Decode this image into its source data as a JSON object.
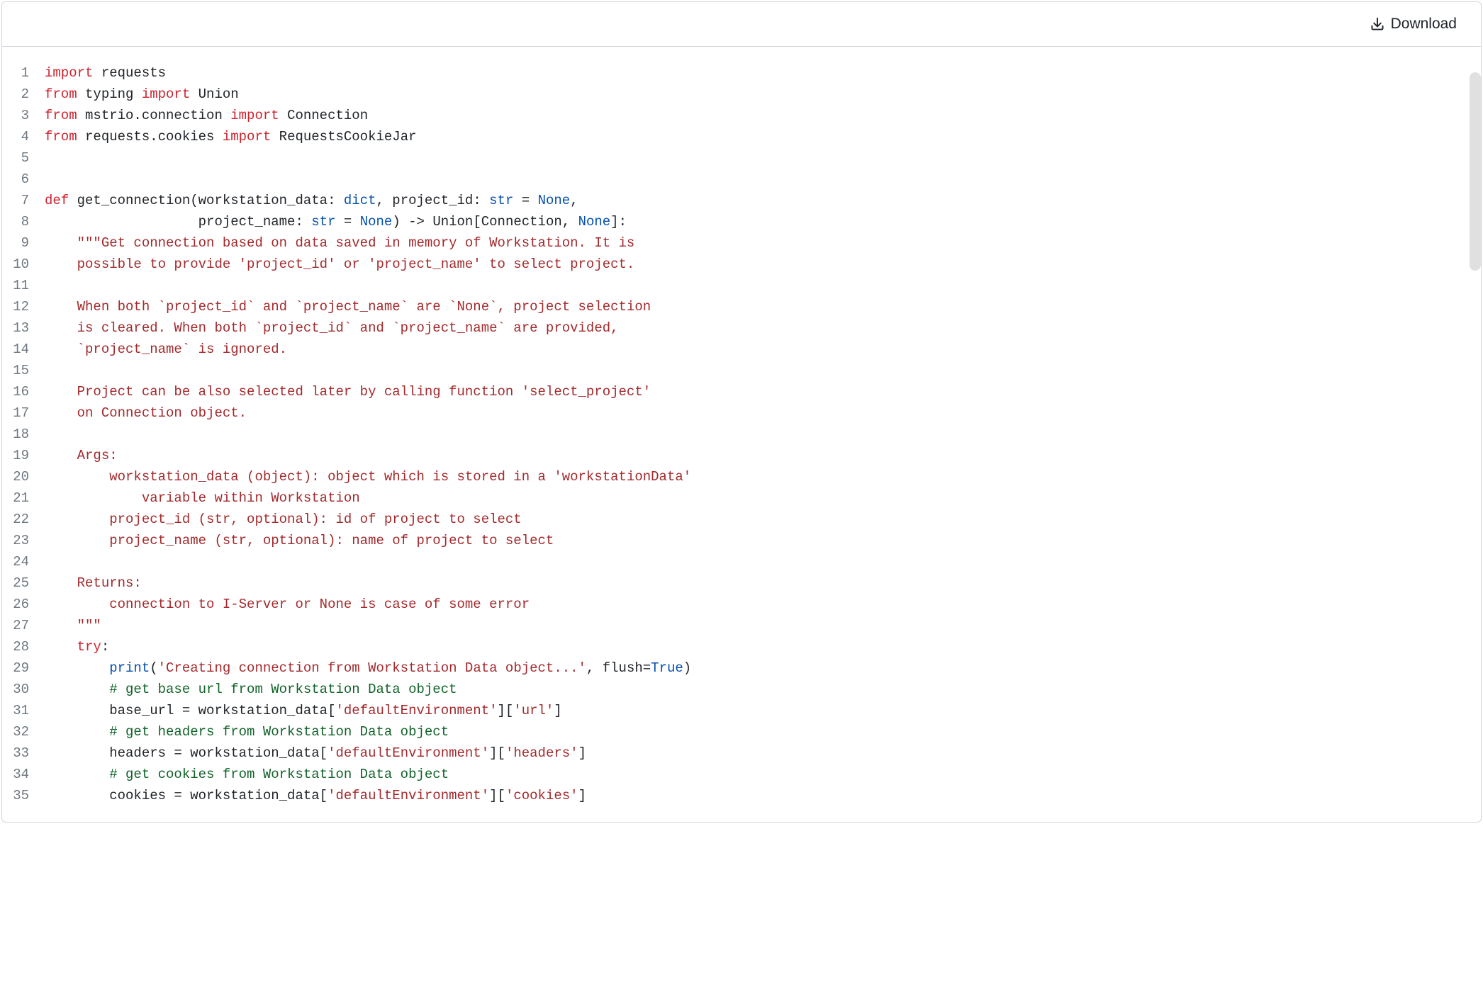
{
  "header": {
    "download_label": "Download"
  },
  "code": {
    "lines": [
      {
        "n": 1,
        "t": [
          [
            "kw",
            "import"
          ],
          [
            "p",
            " requests"
          ]
        ]
      },
      {
        "n": 2,
        "t": [
          [
            "kw",
            "from"
          ],
          [
            "p",
            " typing "
          ],
          [
            "kw",
            "import"
          ],
          [
            "p",
            " Union"
          ]
        ]
      },
      {
        "n": 3,
        "t": [
          [
            "kw",
            "from"
          ],
          [
            "p",
            " mstrio.connection "
          ],
          [
            "kw",
            "import"
          ],
          [
            "p",
            " Connection"
          ]
        ]
      },
      {
        "n": 4,
        "t": [
          [
            "kw",
            "from"
          ],
          [
            "p",
            " requests.cookies "
          ],
          [
            "kw",
            "import"
          ],
          [
            "p",
            " RequestsCookieJar"
          ]
        ]
      },
      {
        "n": 5,
        "t": [
          [
            "p",
            ""
          ]
        ]
      },
      {
        "n": 6,
        "t": [
          [
            "p",
            ""
          ]
        ]
      },
      {
        "n": 7,
        "t": [
          [
            "kw",
            "def"
          ],
          [
            "p",
            " get_connection(workstation_data: "
          ],
          [
            "builtin",
            "dict"
          ],
          [
            "p",
            ", project_id: "
          ],
          [
            "builtin",
            "str"
          ],
          [
            "p",
            " = "
          ],
          [
            "none",
            "None"
          ],
          [
            "p",
            ","
          ]
        ]
      },
      {
        "n": 8,
        "t": [
          [
            "p",
            "                   project_name: "
          ],
          [
            "builtin",
            "str"
          ],
          [
            "p",
            " = "
          ],
          [
            "none",
            "None"
          ],
          [
            "p",
            ") -> Union[Connection, "
          ],
          [
            "none",
            "None"
          ],
          [
            "p",
            "]:"
          ]
        ]
      },
      {
        "n": 9,
        "t": [
          [
            "p",
            "    "
          ],
          [
            "str",
            "\"\"\"Get connection based on data saved in memory of Workstation. It is"
          ]
        ]
      },
      {
        "n": 10,
        "t": [
          [
            "p",
            "    "
          ],
          [
            "str",
            "possible to provide 'project_id' or 'project_name' to select project."
          ]
        ]
      },
      {
        "n": 11,
        "t": [
          [
            "p",
            ""
          ]
        ]
      },
      {
        "n": 12,
        "t": [
          [
            "p",
            "    "
          ],
          [
            "str",
            "When both `project_id` and `project_name` are `None`, project selection"
          ]
        ]
      },
      {
        "n": 13,
        "t": [
          [
            "p",
            "    "
          ],
          [
            "str",
            "is cleared. When both `project_id` and `project_name` are provided,"
          ]
        ]
      },
      {
        "n": 14,
        "t": [
          [
            "p",
            "    "
          ],
          [
            "str",
            "`project_name` is ignored."
          ]
        ]
      },
      {
        "n": 15,
        "t": [
          [
            "p",
            ""
          ]
        ]
      },
      {
        "n": 16,
        "t": [
          [
            "p",
            "    "
          ],
          [
            "str",
            "Project can be also selected later by calling function 'select_project'"
          ]
        ]
      },
      {
        "n": 17,
        "t": [
          [
            "p",
            "    "
          ],
          [
            "str",
            "on Connection object."
          ]
        ]
      },
      {
        "n": 18,
        "t": [
          [
            "p",
            ""
          ]
        ]
      },
      {
        "n": 19,
        "t": [
          [
            "p",
            "    "
          ],
          [
            "str",
            "Args:"
          ]
        ]
      },
      {
        "n": 20,
        "t": [
          [
            "p",
            "        "
          ],
          [
            "str",
            "workstation_data (object): object which is stored in a 'workstationData'"
          ]
        ]
      },
      {
        "n": 21,
        "t": [
          [
            "p",
            "            "
          ],
          [
            "str",
            "variable within Workstation"
          ]
        ]
      },
      {
        "n": 22,
        "t": [
          [
            "p",
            "        "
          ],
          [
            "str",
            "project_id (str, optional): id of project to select"
          ]
        ]
      },
      {
        "n": 23,
        "t": [
          [
            "p",
            "        "
          ],
          [
            "str",
            "project_name (str, optional): name of project to select"
          ]
        ]
      },
      {
        "n": 24,
        "t": [
          [
            "p",
            ""
          ]
        ]
      },
      {
        "n": 25,
        "t": [
          [
            "p",
            "    "
          ],
          [
            "str",
            "Returns:"
          ]
        ]
      },
      {
        "n": 26,
        "t": [
          [
            "p",
            "        "
          ],
          [
            "str",
            "connection to I-Server or None is case of some error"
          ]
        ]
      },
      {
        "n": 27,
        "t": [
          [
            "p",
            "    "
          ],
          [
            "str",
            "\"\"\""
          ]
        ]
      },
      {
        "n": 28,
        "t": [
          [
            "p",
            "    "
          ],
          [
            "kw",
            "try"
          ],
          [
            "p",
            ":"
          ]
        ]
      },
      {
        "n": 29,
        "t": [
          [
            "p",
            "        "
          ],
          [
            "print",
            "print"
          ],
          [
            "p",
            "("
          ],
          [
            "str",
            "'Creating connection from Workstation Data object...'"
          ],
          [
            "p",
            ", flush="
          ],
          [
            "true",
            "True"
          ],
          [
            "p",
            ")"
          ]
        ]
      },
      {
        "n": 30,
        "t": [
          [
            "p",
            "        "
          ],
          [
            "comment",
            "# get base url from Workstation Data object"
          ]
        ]
      },
      {
        "n": 31,
        "t": [
          [
            "p",
            "        base_url = workstation_data["
          ],
          [
            "str",
            "'defaultEnvironment'"
          ],
          [
            "p",
            "]["
          ],
          [
            "str",
            "'url'"
          ],
          [
            "p",
            "]"
          ]
        ]
      },
      {
        "n": 32,
        "t": [
          [
            "p",
            "        "
          ],
          [
            "comment",
            "# get headers from Workstation Data object"
          ]
        ]
      },
      {
        "n": 33,
        "t": [
          [
            "p",
            "        headers = workstation_data["
          ],
          [
            "str",
            "'defaultEnvironment'"
          ],
          [
            "p",
            "]["
          ],
          [
            "str",
            "'headers'"
          ],
          [
            "p",
            "]"
          ]
        ]
      },
      {
        "n": 34,
        "t": [
          [
            "p",
            "        "
          ],
          [
            "comment",
            "# get cookies from Workstation Data object"
          ]
        ]
      },
      {
        "n": 35,
        "t": [
          [
            "p",
            "        cookies = workstation_data["
          ],
          [
            "str",
            "'defaultEnvironment'"
          ],
          [
            "p",
            "]["
          ],
          [
            "str",
            "'cookies'"
          ],
          [
            "p",
            "]"
          ]
        ]
      }
    ]
  }
}
